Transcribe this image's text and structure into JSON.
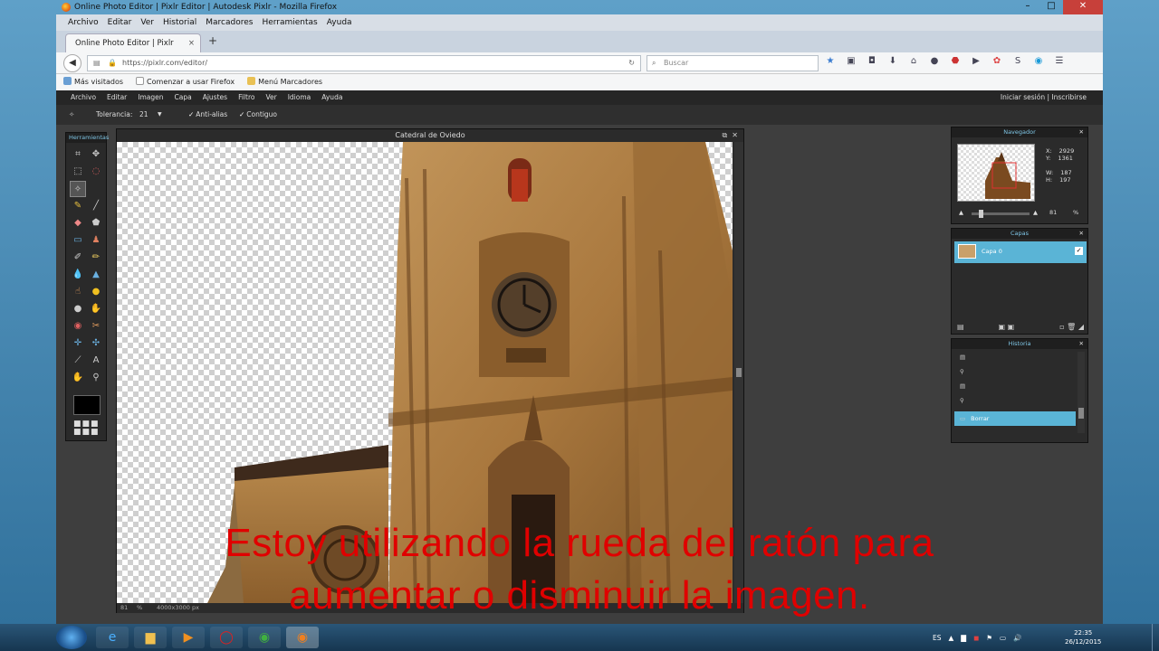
{
  "window": {
    "title": "Online Photo Editor | Pixlr Editor | Autodesk Pixlr - Mozilla Firefox",
    "controls": [
      "–",
      "□",
      "✕"
    ]
  },
  "browser": {
    "menu": [
      "Archivo",
      "Editar",
      "Ver",
      "Historial",
      "Marcadores",
      "Herramientas",
      "Ayuda"
    ],
    "tab_title": "Online Photo Editor | Pixlr Edito...",
    "tab_close": "×",
    "new_tab": "+",
    "url": "https://pixlr.com/editor/",
    "search_placeholder": "Buscar",
    "bookmarks": [
      "Más visitados",
      "Comenzar a usar Firefox",
      "Menú Marcadores"
    ]
  },
  "pixlr": {
    "menu": [
      "Archivo",
      "Editar",
      "Imagen",
      "Capa",
      "Ajustes",
      "Filtro",
      "Ver",
      "Idioma",
      "Ayuda"
    ],
    "auth": "Iniciar sesión  |  Inscribirse",
    "options": {
      "tolerance_label": "Tolerancia:",
      "tolerance_value": "21",
      "antialias_label": "Anti-alias",
      "contiguous_label": "Contiguo",
      "antialias_checked": true,
      "contiguous_checked": true
    },
    "toolbox_title": "Herramientas",
    "document": {
      "title": "Catedral de Oviedo",
      "zoom": "81",
      "zoom_unit": "%",
      "dimensions": "4000x3000 px"
    },
    "navigator": {
      "title": "Navegador",
      "x_label": "X:",
      "x_value": "2929",
      "y_label": "Y:",
      "y_value": "1361",
      "w_label": "W:",
      "w_value": "187",
      "h_label": "H:",
      "h_value": "197",
      "zoom_value": "81",
      "zoom_unit": "%"
    },
    "layers": {
      "title": "Capas",
      "items": [
        {
          "name": "Capa 0",
          "visible": true
        }
      ]
    },
    "history": {
      "title": "Historia",
      "active_item": "Borrar"
    }
  },
  "caption": {
    "line1": "Estoy utilizando la rueda del ratón para",
    "line2": "aumentar o disminuir la imagen."
  },
  "taskbar": {
    "lang": "ES",
    "time": "22:35",
    "date": "26/12/2015"
  },
  "colors": {
    "caption": "#e00000",
    "panel_accent": "#5ab4d6",
    "panel_title": "#7fc6e6"
  }
}
